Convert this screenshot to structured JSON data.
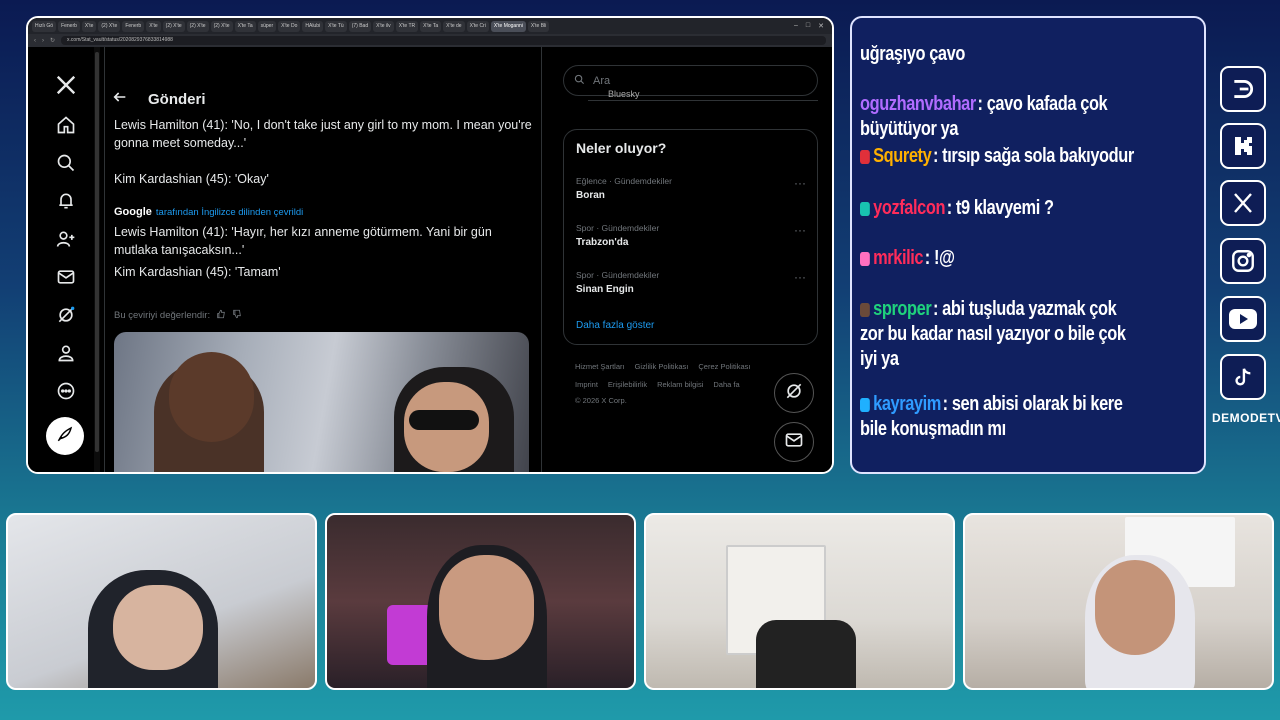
{
  "browser": {
    "tabs": [
      "Hızlı Gö",
      "Fenerb",
      "X'te",
      "(2) X'te",
      "Fenerb",
      "X'te",
      "(2) X'te",
      "(2) X'te",
      "(2) X'te",
      "X'te Ta",
      "süper",
      "X'te Do",
      "HAlubi",
      "X'te Tü",
      "(7) Bad",
      "X'te ilv",
      "X'te TR",
      "X'te Ta",
      "X'te de",
      "X'te Cri",
      "X'te Moganni",
      "X'te Bli"
    ],
    "active_tab_index": 20,
    "url": "x.com/Stat_vault/status/2020829376833814988"
  },
  "x": {
    "page_title": "Gönderi",
    "tweet_lines": [
      "Lewis Hamilton (41): 'No, I don't take just any girl to my mom. I mean you're gonna meet someday...'",
      "Kim Kardashian (45): 'Okay'",
      "Lewis Hamilton (41): 'Hayır, her kızı anneme götürmem. Yani bir gün mutlaka tanışacaksın...'",
      "Kim Kardashian (45): 'Tamam'"
    ],
    "google_label": "Google",
    "translated_by": "tarafından İngilizce dilinden çevrildi",
    "rate_translation": "Bu çeviriyi değerlendir:",
    "search_placeholder": "Ara",
    "bluesky_text": "Bluesky",
    "trends_title": "Neler oluyor?",
    "trends": [
      {
        "category": "Eğlence · Gündemdekiler",
        "name": "Boran"
      },
      {
        "category": "Spor · Gündemdekiler",
        "name": "Trabzon'da"
      },
      {
        "category": "Spor · Gündemdekiler",
        "name": "Sinan Engin"
      }
    ],
    "show_more": "Daha fazla göster",
    "footer_row1": [
      "Hizmet Şartları",
      "Gizlilik Politikası",
      "Çerez Politikası"
    ],
    "footer_row2": [
      "Imprint",
      "Erişilebilirlik",
      "Reklam bilgisi",
      "Daha fa"
    ],
    "copyright": "© 2026 X Corp."
  },
  "chat": {
    "messages": [
      {
        "user": "",
        "text": "uğraşıyo çavo",
        "color": "#ffffff",
        "badge": ""
      },
      {
        "user": "oguzhanvbahar",
        "text": ": çavo kafada çok büyütüyor ya",
        "color": "#b06cff",
        "badge": ""
      },
      {
        "user": "Squrety",
        "text": ": tırsıp sağa sola bakıyodur",
        "color": "#ffb000",
        "badge": "#e0303a"
      },
      {
        "user": "yozfalcon",
        "text": ": t9 klavyemi ?",
        "color": "#ff2c5a",
        "badge": "#18c2b0"
      },
      {
        "user": "mrkilic",
        "text": ": !@",
        "color": "#ff2c5a",
        "badge": "#ff70c0"
      },
      {
        "user": "sproper",
        "text": ": abi tuşluda yazmak çok zor bu kadar nasıl yazıyor o bile çok iyi ya",
        "color": "#1fd27c",
        "badge": "#6a4a3a"
      },
      {
        "user": "kayrayim",
        "text": ": sen abisi olarak bi kere bile konuşmadın mı",
        "color": "#2f9bff",
        "badge": "#1fb0ff"
      }
    ]
  },
  "social": {
    "icons": [
      "kick-d-icon",
      "kick-k-icon",
      "x-icon",
      "instagram-icon",
      "youtube-icon",
      "tiktok-icon"
    ],
    "brand": "DEMODETV"
  }
}
